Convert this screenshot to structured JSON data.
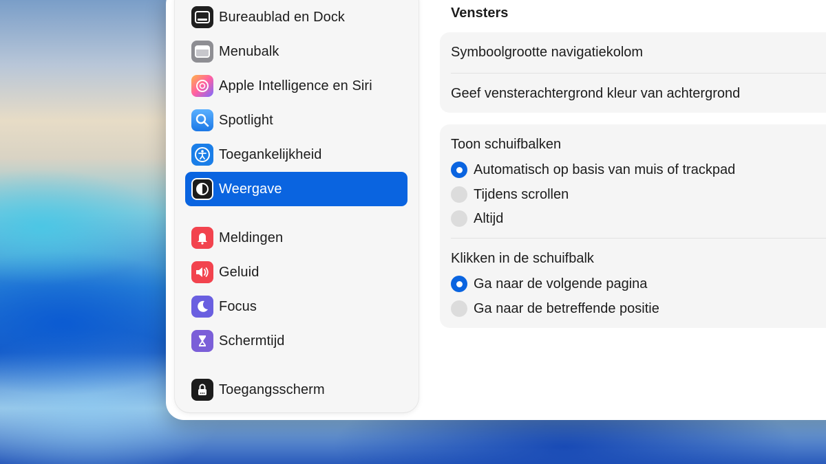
{
  "sidebar": {
    "items": [
      {
        "label": "Bureaublad en Dock",
        "icon": "dock-icon",
        "color": "#1f1f1f"
      },
      {
        "label": "Menubalk",
        "icon": "menubar-icon",
        "color": "#8e8e93"
      },
      {
        "label": "Apple Intelligence en Siri",
        "icon": "apple-intelligence-icon",
        "color": "#ff7ab0"
      },
      {
        "label": "Spotlight",
        "icon": "magnifier-icon",
        "color": "#2f8cf2"
      },
      {
        "label": "Toegankelijkheid",
        "icon": "accessibility-icon",
        "color": "#1a7ee8"
      },
      {
        "label": "Weergave",
        "icon": "appearance-icon",
        "color": "#1c1c1c",
        "selected": true
      },
      {
        "label": "Meldingen",
        "icon": "bell-icon",
        "color": "#f2434e"
      },
      {
        "label": "Geluid",
        "icon": "speaker-icon",
        "color": "#f2434e"
      },
      {
        "label": "Focus",
        "icon": "moon-icon",
        "color": "#6a5fe0"
      },
      {
        "label": "Schermtijd",
        "icon": "hourglass-icon",
        "color": "#7b5fd8"
      },
      {
        "label": "Toegangsscherm",
        "icon": "lock-icon",
        "color": "#1c1c1c"
      }
    ]
  },
  "main": {
    "section_title": "Vensters",
    "window_settings": [
      "Symboolgrootte navigatiekolom",
      "Geef vensterachtergrond kleur van achtergrond"
    ],
    "scrollbars": {
      "title": "Toon schuifbalken",
      "options": [
        {
          "label": "Automatisch op basis van muis of trackpad",
          "selected": true
        },
        {
          "label": "Tijdens scrollen",
          "selected": false
        },
        {
          "label": "Altijd",
          "selected": false
        }
      ]
    },
    "click_scrollbar": {
      "title": "Klikken in de schuifbalk",
      "options": [
        {
          "label": "Ga naar de volgende pagina",
          "selected": true
        },
        {
          "label": "Ga naar de betreffende positie",
          "selected": false
        }
      ]
    }
  },
  "colors": {
    "accent": "#0a64e0"
  }
}
